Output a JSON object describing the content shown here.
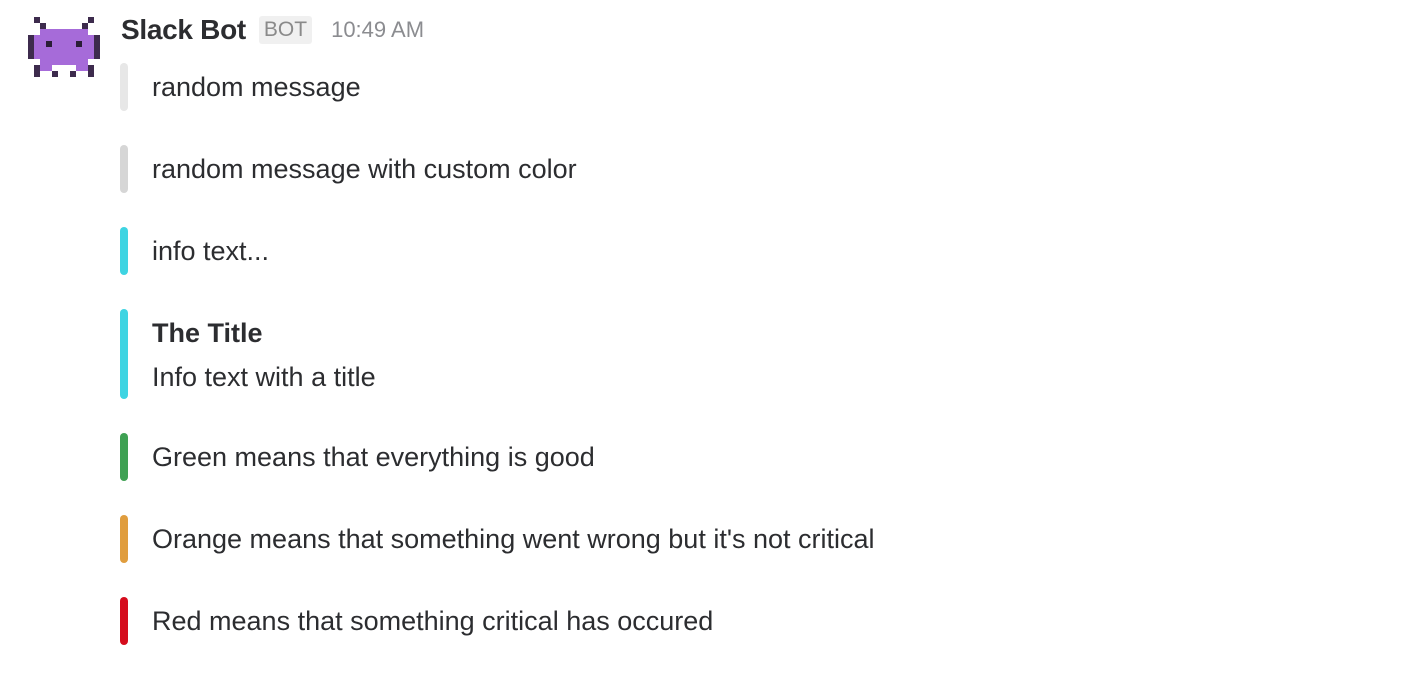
{
  "message": {
    "sender": "Slack Bot",
    "badge": "BOT",
    "time": "10:49 AM",
    "avatar_icon": "purple-alien-monster-icon",
    "avatar_color": "#a66bd9"
  },
  "attachments": [
    {
      "color": "#e7e7e7",
      "title": "",
      "text": "random message"
    },
    {
      "color": "#d6d6d6",
      "title": "",
      "text": "random message with custom color"
    },
    {
      "color": "#3ed4e2",
      "title": "",
      "text": "info text..."
    },
    {
      "color": "#3ed4e2",
      "title": "The Title",
      "text": "Info text with a title"
    },
    {
      "color": "#3fa153",
      "title": "",
      "text": "Green means that everything is good"
    },
    {
      "color": "#e09d3e",
      "title": "",
      "text": "Orange means that something went wrong but it's not critical"
    },
    {
      "color": "#d50c1d",
      "title": "",
      "text": "Red means that something critical has occured"
    }
  ]
}
